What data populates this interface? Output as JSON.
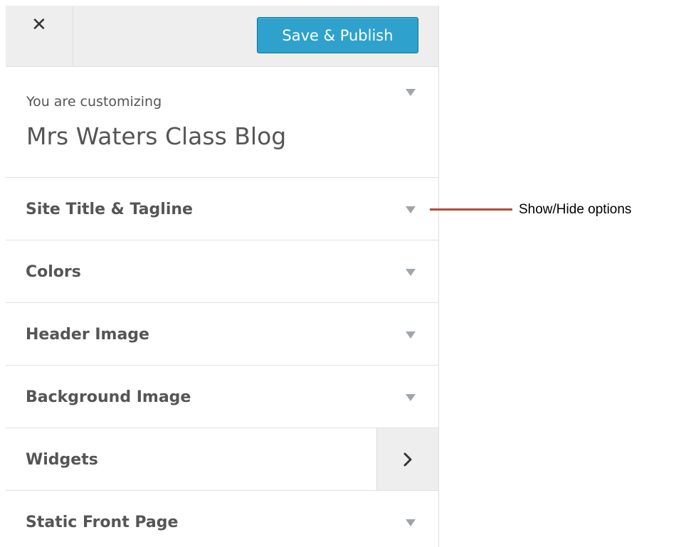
{
  "topbar": {
    "close_glyph": "✕",
    "publish_label": "Save & Publish"
  },
  "info": {
    "small_text": "You are customizing",
    "site_name": "Mrs Waters Class Blog"
  },
  "sections": [
    {
      "label": "Site Title & Tagline",
      "indicator": "down-arrow"
    },
    {
      "label": "Colors",
      "indicator": "down-arrow"
    },
    {
      "label": "Header Image",
      "indicator": "down-arrow"
    },
    {
      "label": "Background Image",
      "indicator": "down-arrow"
    },
    {
      "label": "Widgets",
      "indicator": "chevron-right"
    },
    {
      "label": "Static Front Page",
      "indicator": "down-arrow"
    }
  ],
  "annotation": {
    "text": "Show/Hide options"
  },
  "colors": {
    "publish_button": "#2ea2cc",
    "callout_line": "#b24b3d",
    "topbar_bg": "#eeeeee"
  }
}
